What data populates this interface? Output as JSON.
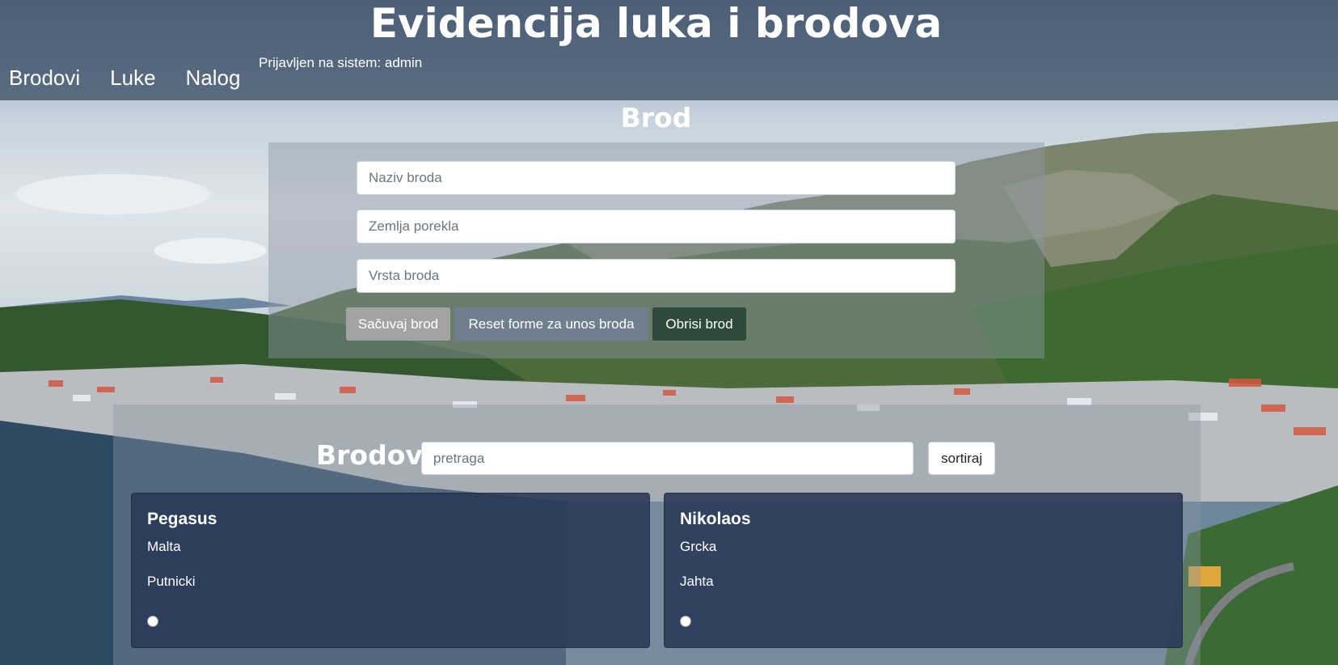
{
  "app_title": "Evidencija luka i brodova",
  "nav": [
    {
      "label": "Brodovi"
    },
    {
      "label": "Luke"
    },
    {
      "label": "Nalog"
    }
  ],
  "login_status": "Prijavljen na sistem: admin",
  "form": {
    "title": "Brod",
    "name_placeholder": "Naziv broda",
    "country_placeholder": "Zemlja porekla",
    "type_placeholder": "Vrsta broda",
    "save_label": "Sačuvaj brod",
    "reset_label": "Reset forme za unos broda",
    "delete_label": "Obrisi brod"
  },
  "list": {
    "title": "Brodovi",
    "search_placeholder": "pretraga",
    "sort_label": "sortiraj",
    "ships": [
      {
        "name": "Pegasus",
        "country": "Malta",
        "type": "Putnicki"
      },
      {
        "name": "Nikolaos",
        "country": "Grcka",
        "type": "Jahta"
      }
    ]
  },
  "colors": {
    "header_overlay": "#344660",
    "card_bg": "#283758",
    "save_button": "#a3a3a3",
    "reset_button": "#6f7f8f",
    "delete_button": "#2f4a3c"
  }
}
